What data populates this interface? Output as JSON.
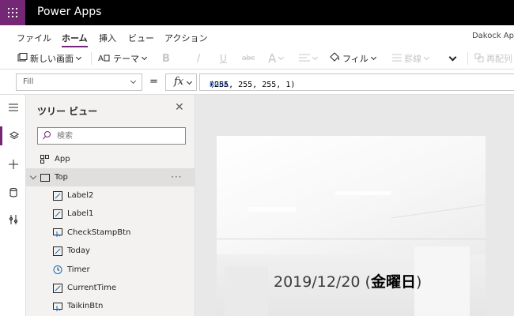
{
  "app": {
    "title": "Power Apps",
    "app_name": "Dakock Ap",
    "accent": "#742774"
  },
  "menu": {
    "items": [
      "ファイル",
      "ホーム",
      "挿入",
      "ビュー",
      "アクション"
    ],
    "active": "ホーム"
  },
  "toolbar": {
    "new_screen": "新しい画面",
    "theme": "テーマ",
    "bold": "B",
    "italic": "/",
    "underline": "U",
    "strike": "abc",
    "font_size": "A",
    "fill": "フィル",
    "border": "罫線",
    "reorder": "再配列"
  },
  "formula": {
    "property": "Fill",
    "equals": "=",
    "fx": "fx",
    "fn_name": "RGBA",
    "args": "(255, 255, 255, 1)"
  },
  "tree": {
    "title": "ツリー ビュー",
    "search_placeholder": "検索",
    "app_item": "App",
    "screen_item": "Top",
    "more": "···",
    "children": [
      {
        "label": "Label2",
        "icon": "label-icon"
      },
      {
        "label": "Label1",
        "icon": "label-icon"
      },
      {
        "label": "CheckStampBtn",
        "icon": "button-icon"
      },
      {
        "label": "Today",
        "icon": "label-icon"
      },
      {
        "label": "Timer",
        "icon": "timer-icon"
      },
      {
        "label": "CurrentTime",
        "icon": "label-icon"
      },
      {
        "label": "TaikinBtn",
        "icon": "button-icon"
      }
    ]
  },
  "canvas": {
    "date_text": "2019/12/20",
    "weekday_text": "金曜日"
  }
}
